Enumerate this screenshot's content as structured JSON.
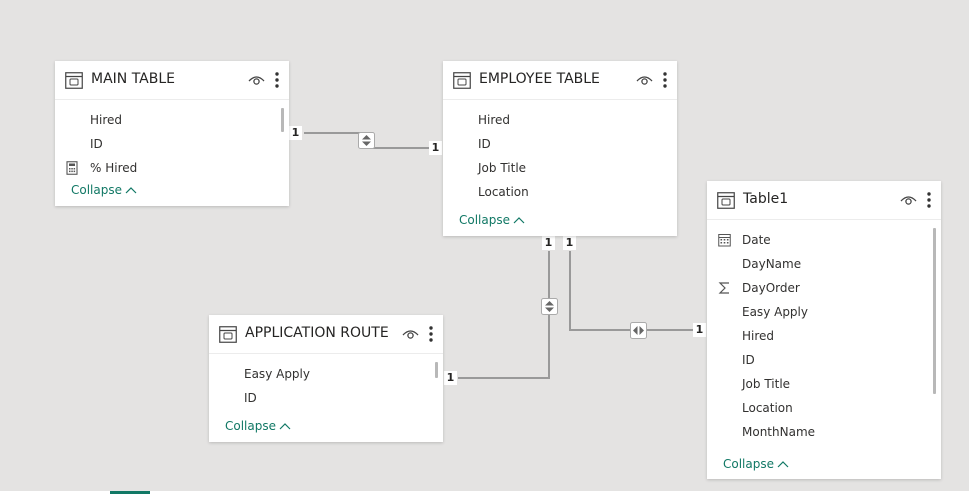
{
  "tables": {
    "main": {
      "title": "MAIN TABLE",
      "fields": [
        {
          "label": "Hired",
          "icon": ""
        },
        {
          "label": "ID",
          "icon": ""
        },
        {
          "label": "% Hired",
          "icon": "measure-calculator-icon"
        }
      ],
      "collapse_label": "Collapse"
    },
    "employee": {
      "title": "EMPLOYEE TABLE",
      "fields": [
        {
          "label": "Hired"
        },
        {
          "label": "ID"
        },
        {
          "label": "Job Title"
        },
        {
          "label": "Location"
        }
      ],
      "collapse_label": "Collapse"
    },
    "application": {
      "title": "APPLICATION ROUTE",
      "fields": [
        {
          "label": "Easy Apply"
        },
        {
          "label": "ID"
        }
      ],
      "collapse_label": "Collapse"
    },
    "table1": {
      "title": "Table1",
      "fields": [
        {
          "label": "Date",
          "icon": "calendar-icon"
        },
        {
          "label": "DayName",
          "icon": ""
        },
        {
          "label": "DayOrder",
          "icon": "sigma-icon"
        },
        {
          "label": "Easy Apply",
          "icon": ""
        },
        {
          "label": "Hired",
          "icon": ""
        },
        {
          "label": "ID",
          "icon": ""
        },
        {
          "label": "Job Title",
          "icon": ""
        },
        {
          "label": "Location",
          "icon": ""
        },
        {
          "label": "MonthName",
          "icon": ""
        }
      ],
      "collapse_label": "Collapse"
    }
  },
  "relationships": [
    {
      "from": "MAIN TABLE",
      "to": "EMPLOYEE TABLE",
      "from_cardinality": "1",
      "to_cardinality": "1",
      "direction": "both"
    },
    {
      "from": "APPLICATION ROUTE",
      "to": "EMPLOYEE TABLE",
      "from_cardinality": "1",
      "to_cardinality": "1",
      "direction": "both"
    },
    {
      "from": "EMPLOYEE TABLE",
      "to": "Table1",
      "from_cardinality": "1",
      "to_cardinality": "1",
      "direction": "both"
    }
  ],
  "colors": {
    "canvas": "#e4e3e2",
    "accent": "#117865",
    "line": "#999999"
  }
}
